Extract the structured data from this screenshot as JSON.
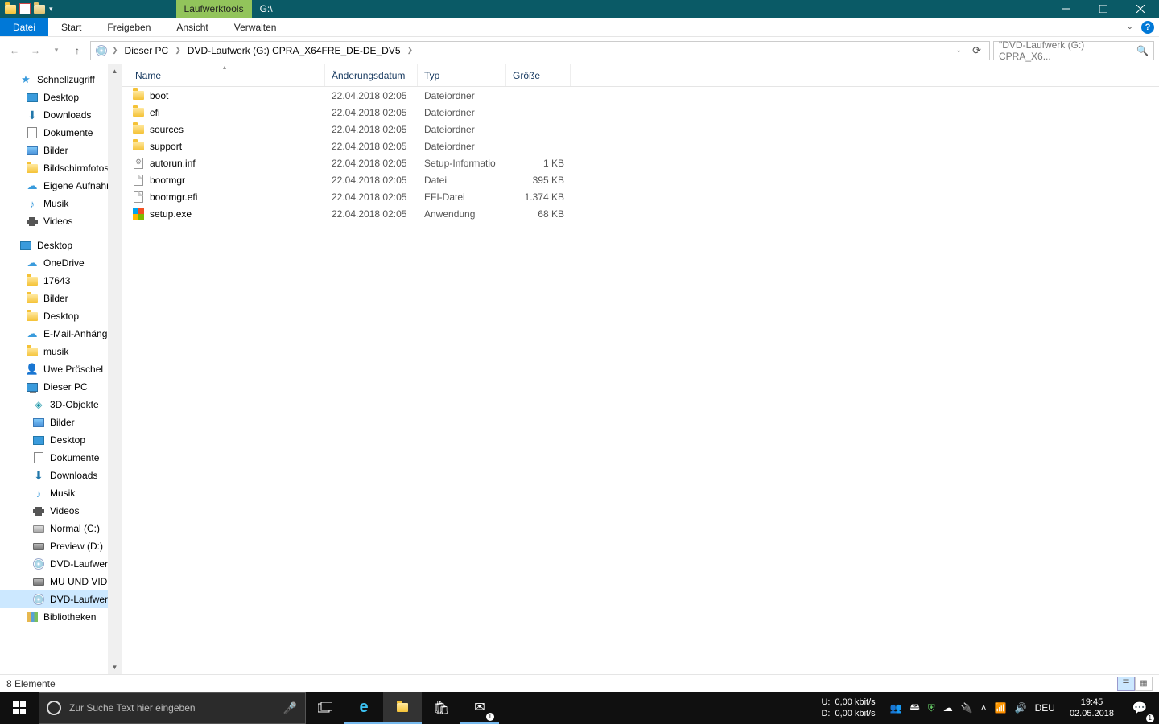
{
  "titlebar": {
    "tool_tab": "Laufwerktools",
    "title": "G:\\"
  },
  "ribbon": {
    "file": "Datei",
    "tabs": [
      "Start",
      "Freigeben",
      "Ansicht",
      "Verwalten"
    ]
  },
  "nav": {
    "breadcrumb": [
      "Dieser PC",
      "DVD-Laufwerk (G:) CPRA_X64FRE_DE-DE_DV5"
    ],
    "search_placeholder": "\"DVD-Laufwerk (G:) CPRA_X6..."
  },
  "sidebar": {
    "quick": {
      "label": "Schnellzugriff",
      "items": [
        {
          "label": "Desktop",
          "icon": "desktop",
          "pin": true
        },
        {
          "label": "Downloads",
          "icon": "dl",
          "pin": true
        },
        {
          "label": "Dokumente",
          "icon": "doc",
          "pin": true
        },
        {
          "label": "Bilder",
          "icon": "pic",
          "pin": true
        },
        {
          "label": "Bildschirmfotos",
          "icon": "folder"
        },
        {
          "label": "Eigene Aufnahm",
          "icon": "cloud"
        },
        {
          "label": "Musik",
          "icon": "music"
        },
        {
          "label": "Videos",
          "icon": "video"
        }
      ]
    },
    "desktop": {
      "label": "Desktop",
      "items": [
        {
          "label": "OneDrive",
          "icon": "cloud"
        },
        {
          "label": "17643",
          "icon": "folder"
        },
        {
          "label": "Bilder",
          "icon": "folder"
        },
        {
          "label": "Desktop",
          "icon": "folder"
        },
        {
          "label": "E-Mail-Anhäng",
          "icon": "cloud"
        },
        {
          "label": "musik",
          "icon": "folder"
        },
        {
          "label": "Uwe Pröschel",
          "icon": "user"
        },
        {
          "label": "Dieser PC",
          "icon": "pc"
        }
      ]
    },
    "pc_items": [
      {
        "label": "3D-Objekte",
        "icon": "3d"
      },
      {
        "label": "Bilder",
        "icon": "pic"
      },
      {
        "label": "Desktop",
        "icon": "desktop"
      },
      {
        "label": "Dokumente",
        "icon": "doc"
      },
      {
        "label": "Downloads",
        "icon": "dl"
      },
      {
        "label": "Musik",
        "icon": "music"
      },
      {
        "label": "Videos",
        "icon": "video"
      },
      {
        "label": "Normal (C:)",
        "icon": "drive"
      },
      {
        "label": "Preview (D:)",
        "icon": "ssd"
      },
      {
        "label": "DVD-Laufwerk",
        "icon": "disc"
      },
      {
        "label": "MU UND VID (F",
        "icon": "ssd"
      },
      {
        "label": "DVD-Laufwerk",
        "icon": "disc",
        "sel": true
      }
    ],
    "libraries": "Bibliotheken"
  },
  "columns": {
    "name": "Name",
    "date": "Änderungsdatum",
    "type": "Typ",
    "size": "Größe"
  },
  "files": [
    {
      "name": "boot",
      "date": "22.04.2018 02:05",
      "type": "Dateiordner",
      "size": "",
      "icon": "folder"
    },
    {
      "name": "efi",
      "date": "22.04.2018 02:05",
      "type": "Dateiordner",
      "size": "",
      "icon": "folder"
    },
    {
      "name": "sources",
      "date": "22.04.2018 02:05",
      "type": "Dateiordner",
      "size": "",
      "icon": "folder"
    },
    {
      "name": "support",
      "date": "22.04.2018 02:05",
      "type": "Dateiordner",
      "size": "",
      "icon": "folder"
    },
    {
      "name": "autorun.inf",
      "date": "22.04.2018 02:05",
      "type": "Setup-Informatio",
      "size": "1 KB",
      "icon": "inf"
    },
    {
      "name": "bootmgr",
      "date": "22.04.2018 02:05",
      "type": "Datei",
      "size": "395 KB",
      "icon": "file"
    },
    {
      "name": "bootmgr.efi",
      "date": "22.04.2018 02:05",
      "type": "EFI-Datei",
      "size": "1.374 KB",
      "icon": "file"
    },
    {
      "name": "setup.exe",
      "date": "22.04.2018 02:05",
      "type": "Anwendung",
      "size": "68 KB",
      "icon": "exe"
    }
  ],
  "status": {
    "count": "8 Elemente"
  },
  "taskbar": {
    "search_placeholder": "Zur Suche Text hier eingeben",
    "net": {
      "u_label": "U:",
      "d_label": "D:",
      "u_val": "0,00 kbit/s",
      "d_val": "0,00 kbit/s"
    },
    "lang": "DEU",
    "time": "19:45",
    "date": "02.05.2018"
  }
}
